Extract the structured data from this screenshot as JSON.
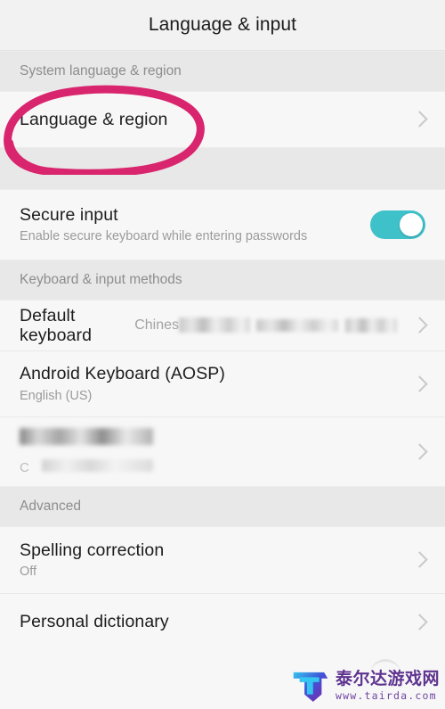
{
  "app": {
    "title": "Language & input"
  },
  "sections": [
    {
      "header": "System language & region",
      "rows": [
        {
          "title": "Language & region",
          "subtitle": "",
          "value": "",
          "accessory": "chevron"
        }
      ]
    },
    {
      "header": "",
      "rows": [
        {
          "title": "Secure input",
          "subtitle": "Enable secure keyboard while entering passwords",
          "value": "",
          "accessory": "toggle-on"
        }
      ]
    },
    {
      "header": "Keyboard & input methods",
      "rows": [
        {
          "title": "Default keyboard",
          "subtitle": "",
          "value": "Chines",
          "value_redacted": true,
          "accessory": "chevron"
        },
        {
          "title": "Android Keyboard (AOSP)",
          "subtitle": "English (US)",
          "value": "",
          "accessory": "chevron"
        },
        {
          "title": "",
          "title_redacted": true,
          "subtitle": "C",
          "subtitle_redacted": true,
          "value": "",
          "accessory": "chevron"
        }
      ]
    },
    {
      "header": "Advanced",
      "rows": [
        {
          "title": "Spelling correction",
          "subtitle": "Off",
          "value": "",
          "accessory": "chevron"
        },
        {
          "title": "Personal dictionary",
          "subtitle": "",
          "value": "",
          "accessory": "chevron"
        }
      ]
    }
  ],
  "annotation": {
    "shape": "hand-drawn-ellipse",
    "color": "#d9246e",
    "targets": "Language & region"
  },
  "toggle": {
    "state": "on",
    "track_color": "#3fc1c9",
    "knob_color": "#ffffff"
  },
  "watermark": {
    "brand_cn": "泰尔达游戏网",
    "url": "www.tairda.com"
  },
  "colors": {
    "row_background": "#f7f7f7",
    "section_band": "#e8e8e8",
    "title_text": "#1d1d1d",
    "secondary_text": "#9b9b9b",
    "accent_teal": "#3fc1c9",
    "annotation_pink": "#d9246e"
  }
}
